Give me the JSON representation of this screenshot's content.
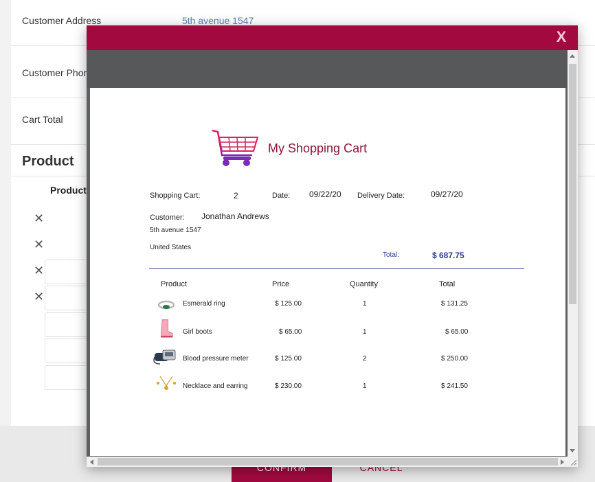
{
  "background_form": {
    "rows": [
      {
        "label": "Customer Address",
        "value": "5th avenue 1547"
      },
      {
        "label": "Customer Phone",
        "value": ""
      },
      {
        "label": "Cart Total",
        "value": ""
      }
    ],
    "section_title": "Product",
    "column_header": "Product",
    "remove_glyph": "✕",
    "confirm_label": "CONFIRM",
    "cancel_label": "CANCEL"
  },
  "modal": {
    "close_label": "X",
    "accent_color": "#a1093f"
  },
  "document": {
    "title": "My Shopping Cart",
    "logo_icon": "shopping-cart-icon",
    "shopping_cart_label": "Shopping Cart:",
    "shopping_cart_number": "2",
    "date_label": "Date:",
    "date_value": "09/22/20",
    "delivery_label": "Delivery Date:",
    "delivery_value": "09/27/20",
    "customer_label": "Customer:",
    "customer_name": "Jonathan Andrews",
    "address_line": "5th avenue 1547",
    "country": "United States",
    "total_label": "Total:",
    "total_value": "$ 687.75",
    "columns": {
      "product": "Product",
      "price": "Price",
      "quantity": "Quantity",
      "total": "Total"
    },
    "items": [
      {
        "name": "Esmerald ring",
        "price": "$ 125.00",
        "quantity": "1",
        "total": "$ 131.25",
        "icon": "ring-icon"
      },
      {
        "name": "Girl boots",
        "price": "$ 65.00",
        "quantity": "1",
        "total": "$ 65.00",
        "icon": "boots-icon"
      },
      {
        "name": "Blood pressure meter",
        "price": "$ 125.00",
        "quantity": "2",
        "total": "$ 250.00",
        "icon": "blood-pressure-meter-icon"
      },
      {
        "name": "Necklace and earring",
        "price": "$ 230.00",
        "quantity": "1",
        "total": "$ 241.50",
        "icon": "necklace-icon"
      }
    ]
  }
}
